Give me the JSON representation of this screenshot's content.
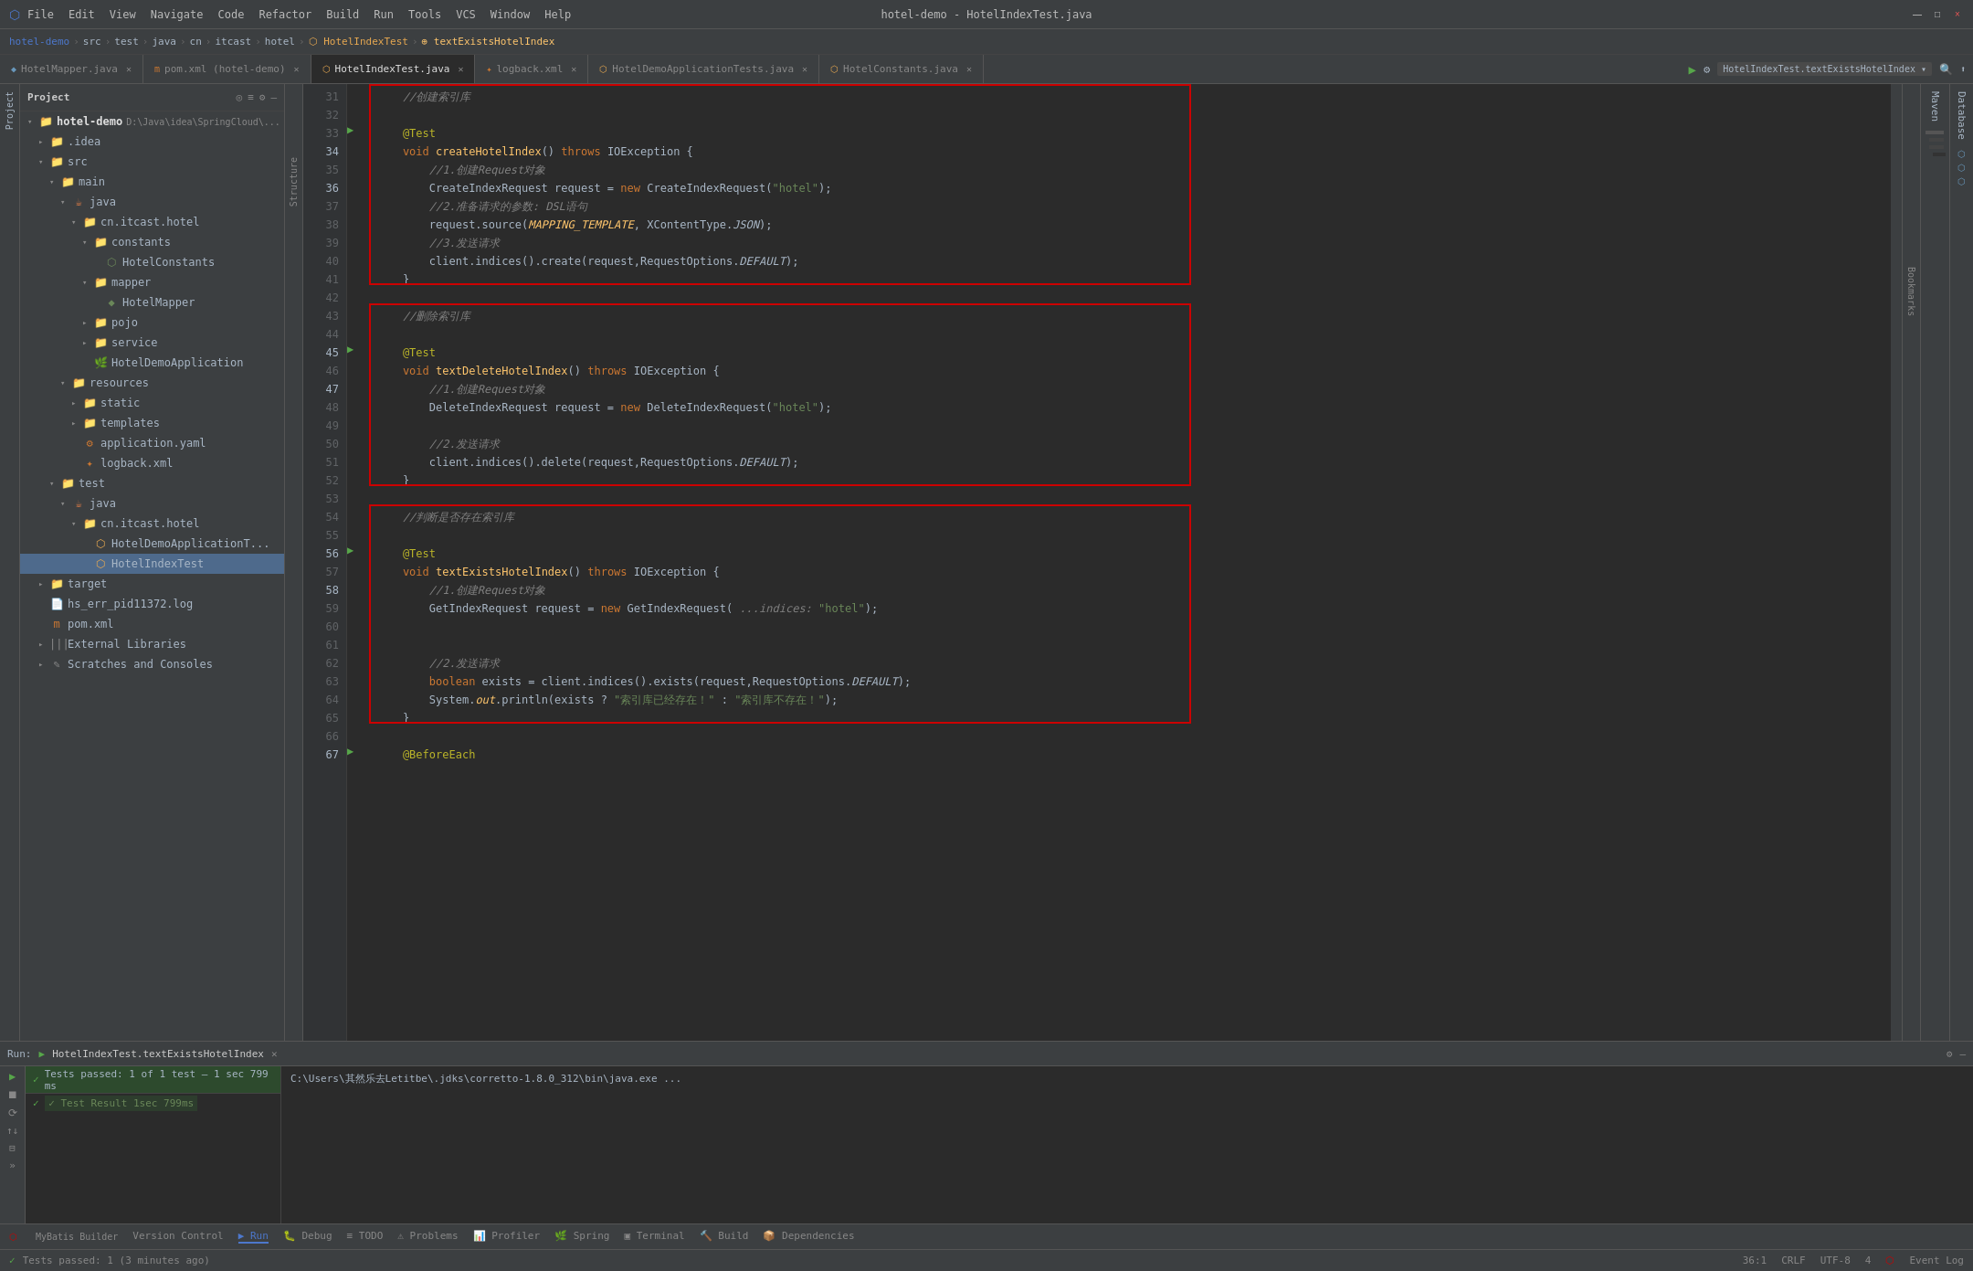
{
  "app": {
    "title": "hotel-demo - HotelIndexTest.java"
  },
  "titlebar": {
    "menus": [
      "File",
      "Edit",
      "View",
      "Navigate",
      "Code",
      "Refactor",
      "Build",
      "Run",
      "Tools",
      "VCS",
      "Window",
      "Help"
    ],
    "controls": [
      "—",
      "□",
      "×"
    ]
  },
  "breadcrumb": {
    "parts": [
      "hotel-demo",
      "src",
      "test",
      "java",
      "cn",
      "itcast",
      "hotel",
      "HotelIndexTest",
      "textExistsHotelIndex"
    ]
  },
  "tabs": [
    {
      "label": "HotelMapper.java",
      "type": "interface",
      "active": false
    },
    {
      "label": "pom.xml (hotel-demo)",
      "type": "xml",
      "active": false
    },
    {
      "label": "HotelIndexTest.java",
      "type": "class",
      "active": true
    },
    {
      "label": "logback.xml",
      "type": "xml",
      "active": false
    },
    {
      "label": "HotelDemoApplicationTests.java",
      "type": "class",
      "active": false
    },
    {
      "label": "HotelConstants.java",
      "type": "class",
      "active": false
    }
  ],
  "sidebar": {
    "project_label": "Project",
    "root": "hotel-demo",
    "root_path": "D:\\Java\\idea\\SpringCloud\\...",
    "tree": [
      {
        "indent": 0,
        "type": "folder",
        "label": ".idea",
        "expanded": false
      },
      {
        "indent": 0,
        "type": "folder",
        "label": "src",
        "expanded": true
      },
      {
        "indent": 1,
        "type": "folder",
        "label": "main",
        "expanded": true
      },
      {
        "indent": 2,
        "type": "folder",
        "label": "java",
        "expanded": true
      },
      {
        "indent": 3,
        "type": "folder",
        "label": "cn.itcast.hotel",
        "expanded": true
      },
      {
        "indent": 4,
        "type": "folder",
        "label": "constants",
        "expanded": true
      },
      {
        "indent": 5,
        "type": "class",
        "label": "HotelConstants",
        "expanded": false
      },
      {
        "indent": 4,
        "type": "folder",
        "label": "mapper",
        "expanded": true
      },
      {
        "indent": 5,
        "type": "class",
        "label": "HotelMapper",
        "expanded": false
      },
      {
        "indent": 4,
        "type": "folder",
        "label": "pojo",
        "expanded": false
      },
      {
        "indent": 4,
        "type": "folder",
        "label": "service",
        "expanded": false
      },
      {
        "indent": 3,
        "type": "class",
        "label": "HotelDemoApplication",
        "expanded": false
      },
      {
        "indent": 2,
        "type": "folder",
        "label": "resources",
        "expanded": true
      },
      {
        "indent": 3,
        "type": "folder",
        "label": "static",
        "expanded": false
      },
      {
        "indent": 3,
        "type": "folder",
        "label": "templates",
        "expanded": false
      },
      {
        "indent": 3,
        "type": "yaml",
        "label": "application.yaml",
        "expanded": false
      },
      {
        "indent": 3,
        "type": "xml",
        "label": "logback.xml",
        "expanded": false
      },
      {
        "indent": 1,
        "type": "folder",
        "label": "test",
        "expanded": true
      },
      {
        "indent": 2,
        "type": "folder",
        "label": "java",
        "expanded": true
      },
      {
        "indent": 3,
        "type": "folder",
        "label": "cn.itcast.hotel",
        "expanded": true
      },
      {
        "indent": 4,
        "type": "class_test",
        "label": "HotelDemoApplicationT...",
        "expanded": false
      },
      {
        "indent": 4,
        "type": "class_test",
        "label": "HotelIndexTest",
        "selected": true,
        "expanded": false
      },
      {
        "indent": 0,
        "type": "folder",
        "label": "target",
        "expanded": false
      },
      {
        "indent": 0,
        "type": "file",
        "label": "hs_err_pid11372.log",
        "expanded": false
      },
      {
        "indent": 0,
        "type": "xml",
        "label": "pom.xml",
        "expanded": false
      },
      {
        "indent": 0,
        "type": "folder",
        "label": "External Libraries",
        "expanded": false
      },
      {
        "indent": 0,
        "type": "folder",
        "label": "Scratches and Consoles",
        "expanded": false
      }
    ]
  },
  "editor": {
    "lines": [
      {
        "num": 31,
        "code": "    <span class='cmt'>//创建索引库</span>"
      },
      {
        "num": 32,
        "code": ""
      },
      {
        "num": 33,
        "code": "    <span class='ann'>@Test</span>"
      },
      {
        "num": 34,
        "code": "    <span class='kw'>void</span> <span class='fn'>createHotelIndex</span>() <span class='kw'>throws</span> IOException {"
      },
      {
        "num": 35,
        "code": "        <span class='cmt'>//1.创建Request对象</span>"
      },
      {
        "num": 36,
        "code": "        CreateIndexRequest request = <span class='kw'>new</span> CreateIndexRequest(<span class='str'>\"hotel\"</span>);"
      },
      {
        "num": 37,
        "code": "        <span class='cmt'>//2.准备请求的参数: DSL语句</span>"
      },
      {
        "num": 38,
        "code": "        request.source(<span class='fn italic'>MAPPING_TEMPLATE</span>, XContentType.<span class='italic'>JSON</span>);"
      },
      {
        "num": 39,
        "code": "        <span class='cmt'>//3.发送请求</span>"
      },
      {
        "num": 40,
        "code": "        client.indices().create(request,RequestOptions.<span class='italic'>DEFAULT</span>);"
      },
      {
        "num": 41,
        "code": "    }"
      },
      {
        "num": 42,
        "code": ""
      },
      {
        "num": 43,
        "code": "    <span class='cmt'>//删除索引库</span>"
      },
      {
        "num": 44,
        "code": ""
      },
      {
        "num": 45,
        "code": "    <span class='ann'>@Test</span>"
      },
      {
        "num": 46,
        "code": "    <span class='kw'>void</span> <span class='fn'>textDeleteHotelIndex</span>() <span class='kw'>throws</span> IOException {"
      },
      {
        "num": 47,
        "code": "        <span class='cmt'>//1.创建Request对象</span>"
      },
      {
        "num": 48,
        "code": "        DeleteIndexRequest request = <span class='kw'>new</span> DeleteIndexRequest(<span class='str'>\"hotel\"</span>);"
      },
      {
        "num": 49,
        "code": ""
      },
      {
        "num": 50,
        "code": "        <span class='cmt'>//2.发送请求</span>"
      },
      {
        "num": 51,
        "code": "        client.indices().delete(request,RequestOptions.<span class='italic'>DEFAULT</span>);"
      },
      {
        "num": 52,
        "code": "    }"
      },
      {
        "num": 53,
        "code": ""
      },
      {
        "num": 54,
        "code": "    <span class='cmt'>//判断是否存在索引库</span>"
      },
      {
        "num": 55,
        "code": ""
      },
      {
        "num": 56,
        "code": "    <span class='ann'>@Test</span>"
      },
      {
        "num": 57,
        "code": "    <span class='kw'>void</span> <span class='fn'>textExistsHotelIndex</span>() <span class='kw'>throws</span> IOException {"
      },
      {
        "num": 58,
        "code": "        <span class='cmt'>//1.创建Request对象</span>"
      },
      {
        "num": 59,
        "code": "        GetIndexRequest request = <span class='kw'>new</span> GetIndexRequest( <span class='str'><span class='cmt'>...indices: </span>\"hotel\"</span>);"
      },
      {
        "num": 60,
        "code": ""
      },
      {
        "num": 61,
        "code": ""
      },
      {
        "num": 62,
        "code": "        <span class='cmt'>//2.发送请求</span>"
      },
      {
        "num": 63,
        "code": "        <span class='kw'>boolean</span> exists = client.indices().exists(request,RequestOptions.<span class='italic'>DEFAULT</span>);"
      },
      {
        "num": 64,
        "code": "        System.<span class='fn italic'>out</span>.println(exists ? <span class='str'>\"索引库已经存在！\"</span> : <span class='str'>\"索引库不存在！\"</span>);"
      },
      {
        "num": 65,
        "code": "    }"
      },
      {
        "num": 66,
        "code": ""
      },
      {
        "num": 67,
        "code": "    <span class='ann'>@BeforeEach</span>"
      }
    ]
  },
  "run": {
    "tab_label": "Run:",
    "run_config": "HotelIndexTest.textExistsHotelIndex",
    "toolbar_icons": [
      "▶",
      "⏹",
      "⟳",
      "↑",
      "↓",
      "⊟",
      "»"
    ],
    "check_label": "Tests passed: 1 of 1 test — 1 sec 799 ms",
    "result_label": "✓ Test Result 1sec 799ms",
    "output": "C:\\Users\\其然乐去Letitbe\\.jdks\\corretto-1.8.0_312\\bin\\java.exe ..."
  },
  "bottom_tools": [
    {
      "label": "Version Control",
      "active": false
    },
    {
      "label": "Run",
      "active": true
    },
    {
      "label": "Debug",
      "active": false
    },
    {
      "label": "TODO",
      "active": false
    },
    {
      "label": "Problems",
      "active": false
    },
    {
      "label": "Profiler",
      "active": false
    },
    {
      "label": "Spring",
      "active": false
    },
    {
      "label": "Terminal",
      "active": false
    },
    {
      "label": "Build",
      "active": false
    },
    {
      "label": "Dependencies",
      "active": false
    }
  ],
  "status_bar": {
    "left": "Tests passed: 1 (3 minutes ago)",
    "position": "36:1",
    "encoding": "CRLF",
    "charset": "UTF-8",
    "indent": "4",
    "event_log": "Event Log"
  },
  "right_panels": {
    "maven_label": "Maven",
    "database_label": "Database"
  },
  "left_panels": {
    "structure_label": "Structure",
    "bookmarks_label": "Bookmarks",
    "mybatis_label": "MyBatis Builder"
  }
}
